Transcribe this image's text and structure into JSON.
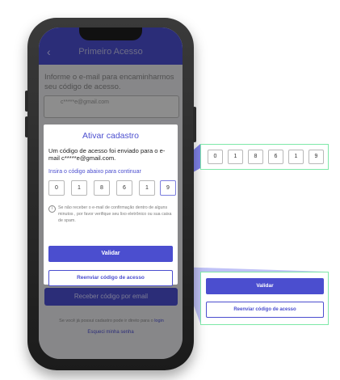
{
  "app": {
    "title": "Primeiro Acesso",
    "back_icon": "chevron-left-icon",
    "intro": "Informe o e-mail para encaminharmos seu código de acesso.",
    "email_value": "c*****e@gmail.com",
    "send_button": "Receber código por email",
    "login_note_prefix": "Se você já possui cadastro pode ir direto para o",
    "login_link": "login",
    "forgot_password": "Esqueci minha senha"
  },
  "modal": {
    "title": "Ativar cadastro",
    "message": "Um código de acesso foi enviado para o e-mail c*****e@gmail.com.",
    "prompt": "Insira o código abaixo para continuar",
    "code_digits": [
      "0",
      "1",
      "8",
      "6",
      "1",
      "9"
    ],
    "info_icon": "info-icon",
    "info_text": "Se não receber o e-mail de confirmação dentro de alguns minutos , por favor verifique seu lixo eletrônico ou sua caixa de spam.",
    "validate_button": "Validar",
    "resend_button": "Reenviar código de acesso"
  },
  "zoom": {
    "code_digits": [
      "0",
      "1",
      "8",
      "6",
      "1",
      "9"
    ],
    "validate_button": "Validar",
    "resend_button": "Reenviar código de acesso"
  },
  "colors": {
    "primary": "#4b4ecf",
    "callout_border": "#7ee8a8"
  }
}
